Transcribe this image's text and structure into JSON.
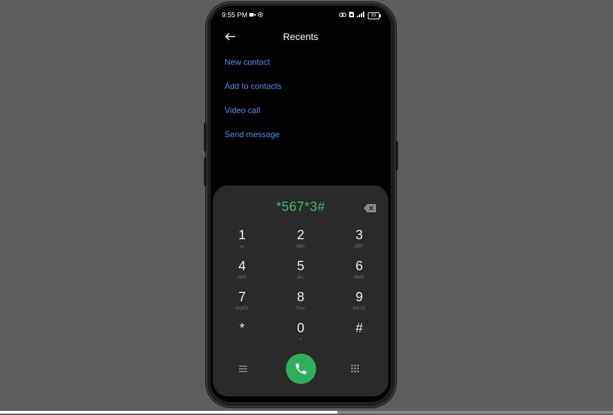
{
  "status_bar": {
    "time": "9:55 PM",
    "battery": "83",
    "icons": [
      "video-record-icon",
      "settings-gear-icon",
      "link-icon",
      "sim-icon",
      "signal-icon",
      "battery-icon"
    ]
  },
  "header": {
    "title": "Recents",
    "back_icon": "arrow-left-icon"
  },
  "menu": {
    "items": [
      {
        "label": "New contact"
      },
      {
        "label": "Add to contacts"
      },
      {
        "label": "Video call"
      },
      {
        "label": "Send message"
      }
    ]
  },
  "dialpad": {
    "number": "*567*3#",
    "keys": [
      {
        "digit": "1",
        "letters": "ω"
      },
      {
        "digit": "2",
        "letters": "ABC"
      },
      {
        "digit": "3",
        "letters": "DEF"
      },
      {
        "digit": "4",
        "letters": "GHI"
      },
      {
        "digit": "5",
        "letters": "JKL"
      },
      {
        "digit": "6",
        "letters": "MNO"
      },
      {
        "digit": "7",
        "letters": "PQRS"
      },
      {
        "digit": "8",
        "letters": "TUV"
      },
      {
        "digit": "9",
        "letters": "WXYZ"
      },
      {
        "digit": "*",
        "letters": ","
      },
      {
        "digit": "0",
        "letters": "+"
      },
      {
        "digit": "#",
        "letters": ""
      }
    ]
  },
  "colors": {
    "accent_blue": "#4a8df0",
    "number_green": "#36c06c",
    "call_green": "#2fae5c",
    "panel": "#2a2a2a"
  },
  "video_progress": 0.55
}
